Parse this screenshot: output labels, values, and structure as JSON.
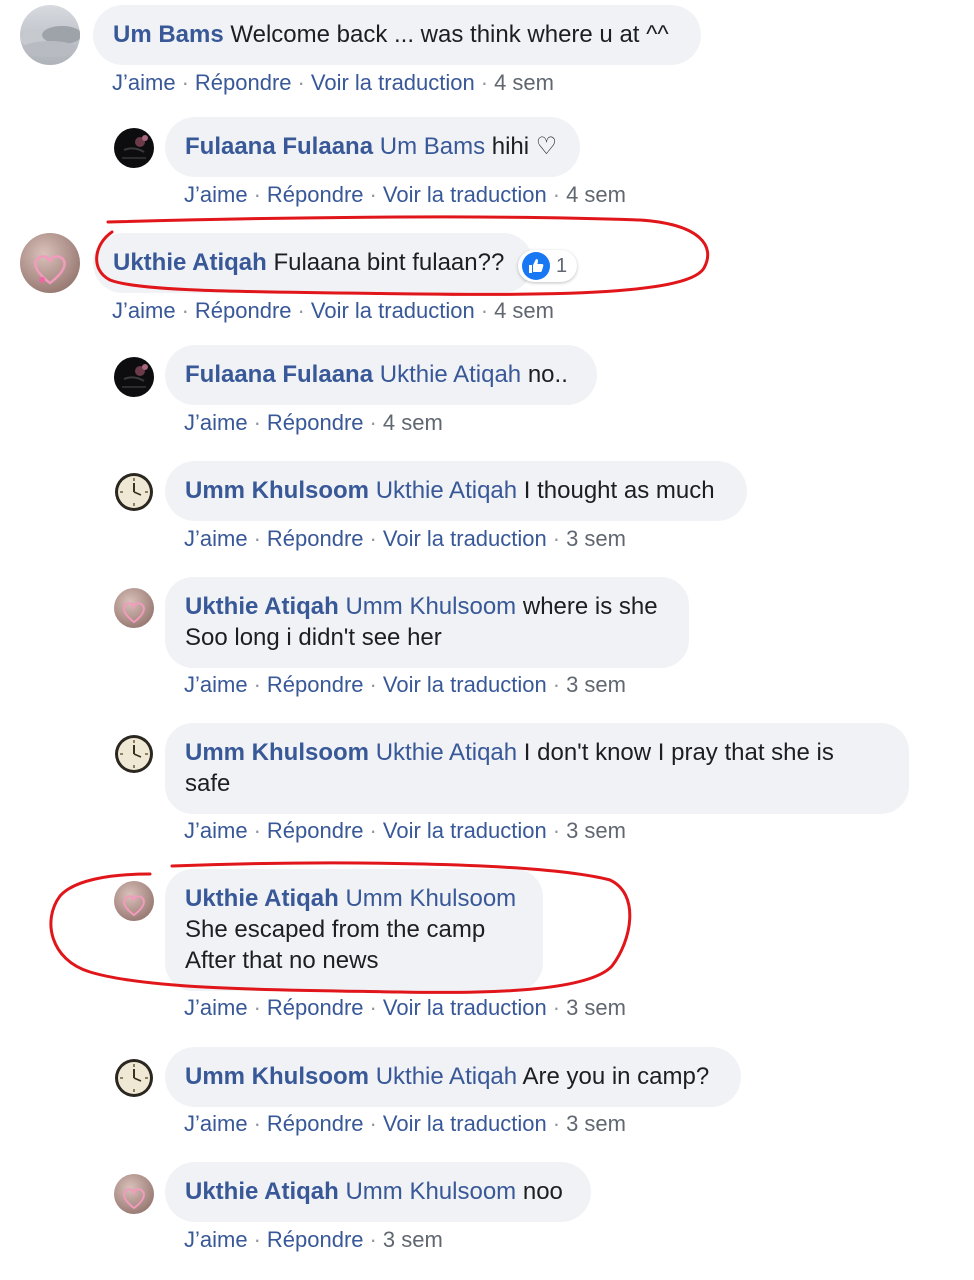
{
  "actions": {
    "like": "J’aime",
    "reply": "Répondre",
    "translate": "Voir la traduction"
  },
  "comments": [
    {
      "author": "Um Bams",
      "mention": "",
      "lines": [
        "Welcome back ... was think where u at ^^"
      ],
      "time": "4 sem",
      "avatar": "clouds-avatar"
    },
    {
      "author": "Fulaana Fulaana",
      "mention": "Um Bams",
      "lines": [
        "hihi ♡"
      ],
      "time": "4 sem",
      "avatar": "dark-flower-avatar"
    },
    {
      "author": "Ukthie Atiqah",
      "mention": "",
      "lines": [
        "Fulaana bint fulaan??"
      ],
      "time": "4 sem",
      "avatar": "heart-avatar",
      "reaction_count": "1"
    },
    {
      "author": "Fulaana Fulaana",
      "mention": "Ukthie Atiqah",
      "lines": [
        "no.."
      ],
      "time": "4 sem",
      "avatar": "dark-flower-avatar"
    },
    {
      "author": "Umm Khulsoom",
      "mention": "Ukthie Atiqah",
      "lines": [
        "I thought as much"
      ],
      "time": "3 sem",
      "avatar": "clock-avatar"
    },
    {
      "author": "Ukthie Atiqah",
      "mention": "Umm Khulsoom",
      "lines": [
        "where is she",
        "Soo long i didn't see her"
      ],
      "time": "3 sem",
      "avatar": "heart-avatar"
    },
    {
      "author": "Umm Khulsoom",
      "mention": "Ukthie Atiqah",
      "lines": [
        "I don't know I pray that she is",
        "safe"
      ],
      "time": "3 sem",
      "avatar": "clock-avatar"
    },
    {
      "author": "Ukthie Atiqah",
      "mention": "Umm Khulsoom",
      "lines": [
        "She escaped from the camp",
        "After that no news"
      ],
      "time": "3 sem",
      "avatar": "heart-avatar"
    },
    {
      "author": "Umm Khulsoom",
      "mention": "Ukthie Atiqah",
      "lines": [
        "Are you in camp?"
      ],
      "time": "3 sem",
      "avatar": "clock-avatar"
    },
    {
      "author": "Ukthie Atiqah",
      "mention": "Umm Khulsoom",
      "lines": [
        "noo"
      ],
      "time": "3 sem",
      "avatar": "heart-avatar"
    }
  ],
  "colors": {
    "author": "#385898",
    "bubble": "#f0f2f5",
    "annotation": "#e0161b"
  }
}
